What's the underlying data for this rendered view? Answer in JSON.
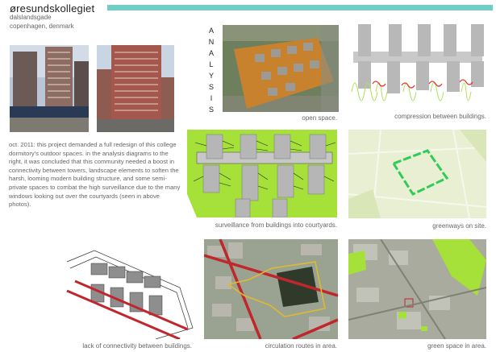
{
  "header": {
    "title": "øresundskollegiet",
    "subtitle_street": "dalslandsgade",
    "subtitle_city": "copenhagen, denmark"
  },
  "sidebar_word": [
    "A",
    "N",
    "A",
    "L",
    "Y",
    "S",
    "I",
    "S"
  ],
  "description": "oct. 2011: this project demanded a full redesign of this college dormitory's outdoor spaces. in the analysis diagrams to the right, it was concluded that this community needed a boost in connectivity between towers, landscape elements to soften the harsh, looming modern building structure, and some semi-private spaces to combat the high surveillance due to the many windows looking out over the courtyards (seen in above photos).",
  "captions": {
    "open_space": "open space.",
    "compression": "compression between buildings.",
    "surveillance": "surveillance from buildings into courtyards.",
    "greenways": "greenways on site.",
    "connectivity": "lack of connectivity between buildings.",
    "circulation": "circulation routes in area.",
    "green_space": "green space in area."
  },
  "colors": {
    "accent": "#6fcfc4",
    "orange": "#c8822e",
    "lime": "#a6e13a",
    "green_path": "#2ecc55",
    "red_route": "#c0272d",
    "yellow_route": "#e0b92e"
  }
}
